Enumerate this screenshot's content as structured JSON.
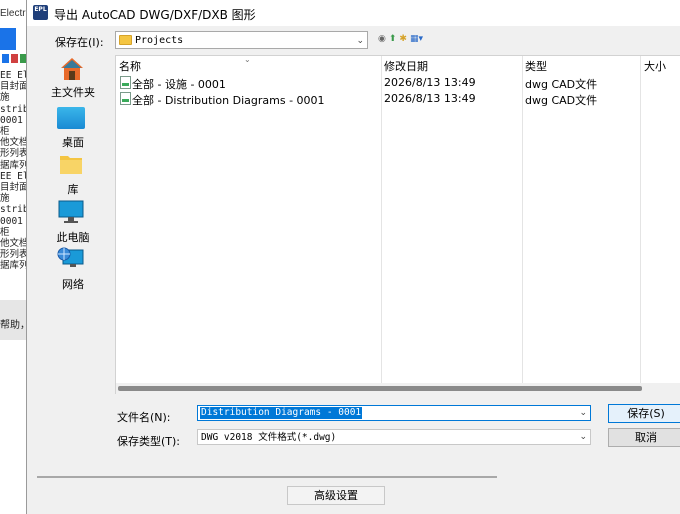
{
  "background_app": {
    "title": "Electri",
    "lines": [
      "EE El",
      "目封面",
      "施",
      "stribu",
      "0001",
      "柜",
      "他文档",
      "形列表",
      "据库列",
      "EE El",
      "目封面",
      "施",
      "stribu",
      "0001",
      "柜",
      "他文档",
      "形列表",
      "据库列"
    ],
    "bottom_text": "帮助，"
  },
  "dialog": {
    "title": "导出 AutoCAD DWG/DXF/DXB 图形",
    "app_icon_text": "EPL"
  },
  "location": {
    "label": "保存在(I):",
    "value": "Projects"
  },
  "places": [
    {
      "name": "home",
      "label": "主文件夹"
    },
    {
      "name": "desktop",
      "label": "桌面"
    },
    {
      "name": "library",
      "label": "库"
    },
    {
      "name": "this-pc",
      "label": "此电脑"
    },
    {
      "name": "network",
      "label": "网络"
    }
  ],
  "columns": {
    "name": "名称",
    "modified": "修改日期",
    "type": "类型",
    "size": "大小"
  },
  "files": [
    {
      "name": "全部 - 设施 - 0001",
      "modified": "2026/8/13 13:49",
      "type": "dwg CAD文件"
    },
    {
      "name": "全部 - Distribution Diagrams - 0001",
      "modified": "2026/8/13 13:49",
      "type": "dwg CAD文件"
    }
  ],
  "filename": {
    "label": "文件名(N):",
    "value": "Distribution Diagrams - 0001"
  },
  "filetype": {
    "label": "保存类型(T):",
    "value": "DWG v2018 文件格式(*.dwg)"
  },
  "buttons": {
    "save": "保存(S)",
    "cancel": "取消",
    "advanced": "高级设置"
  },
  "colors": {
    "accent": "#0078d7",
    "folder": "#f4c542"
  }
}
